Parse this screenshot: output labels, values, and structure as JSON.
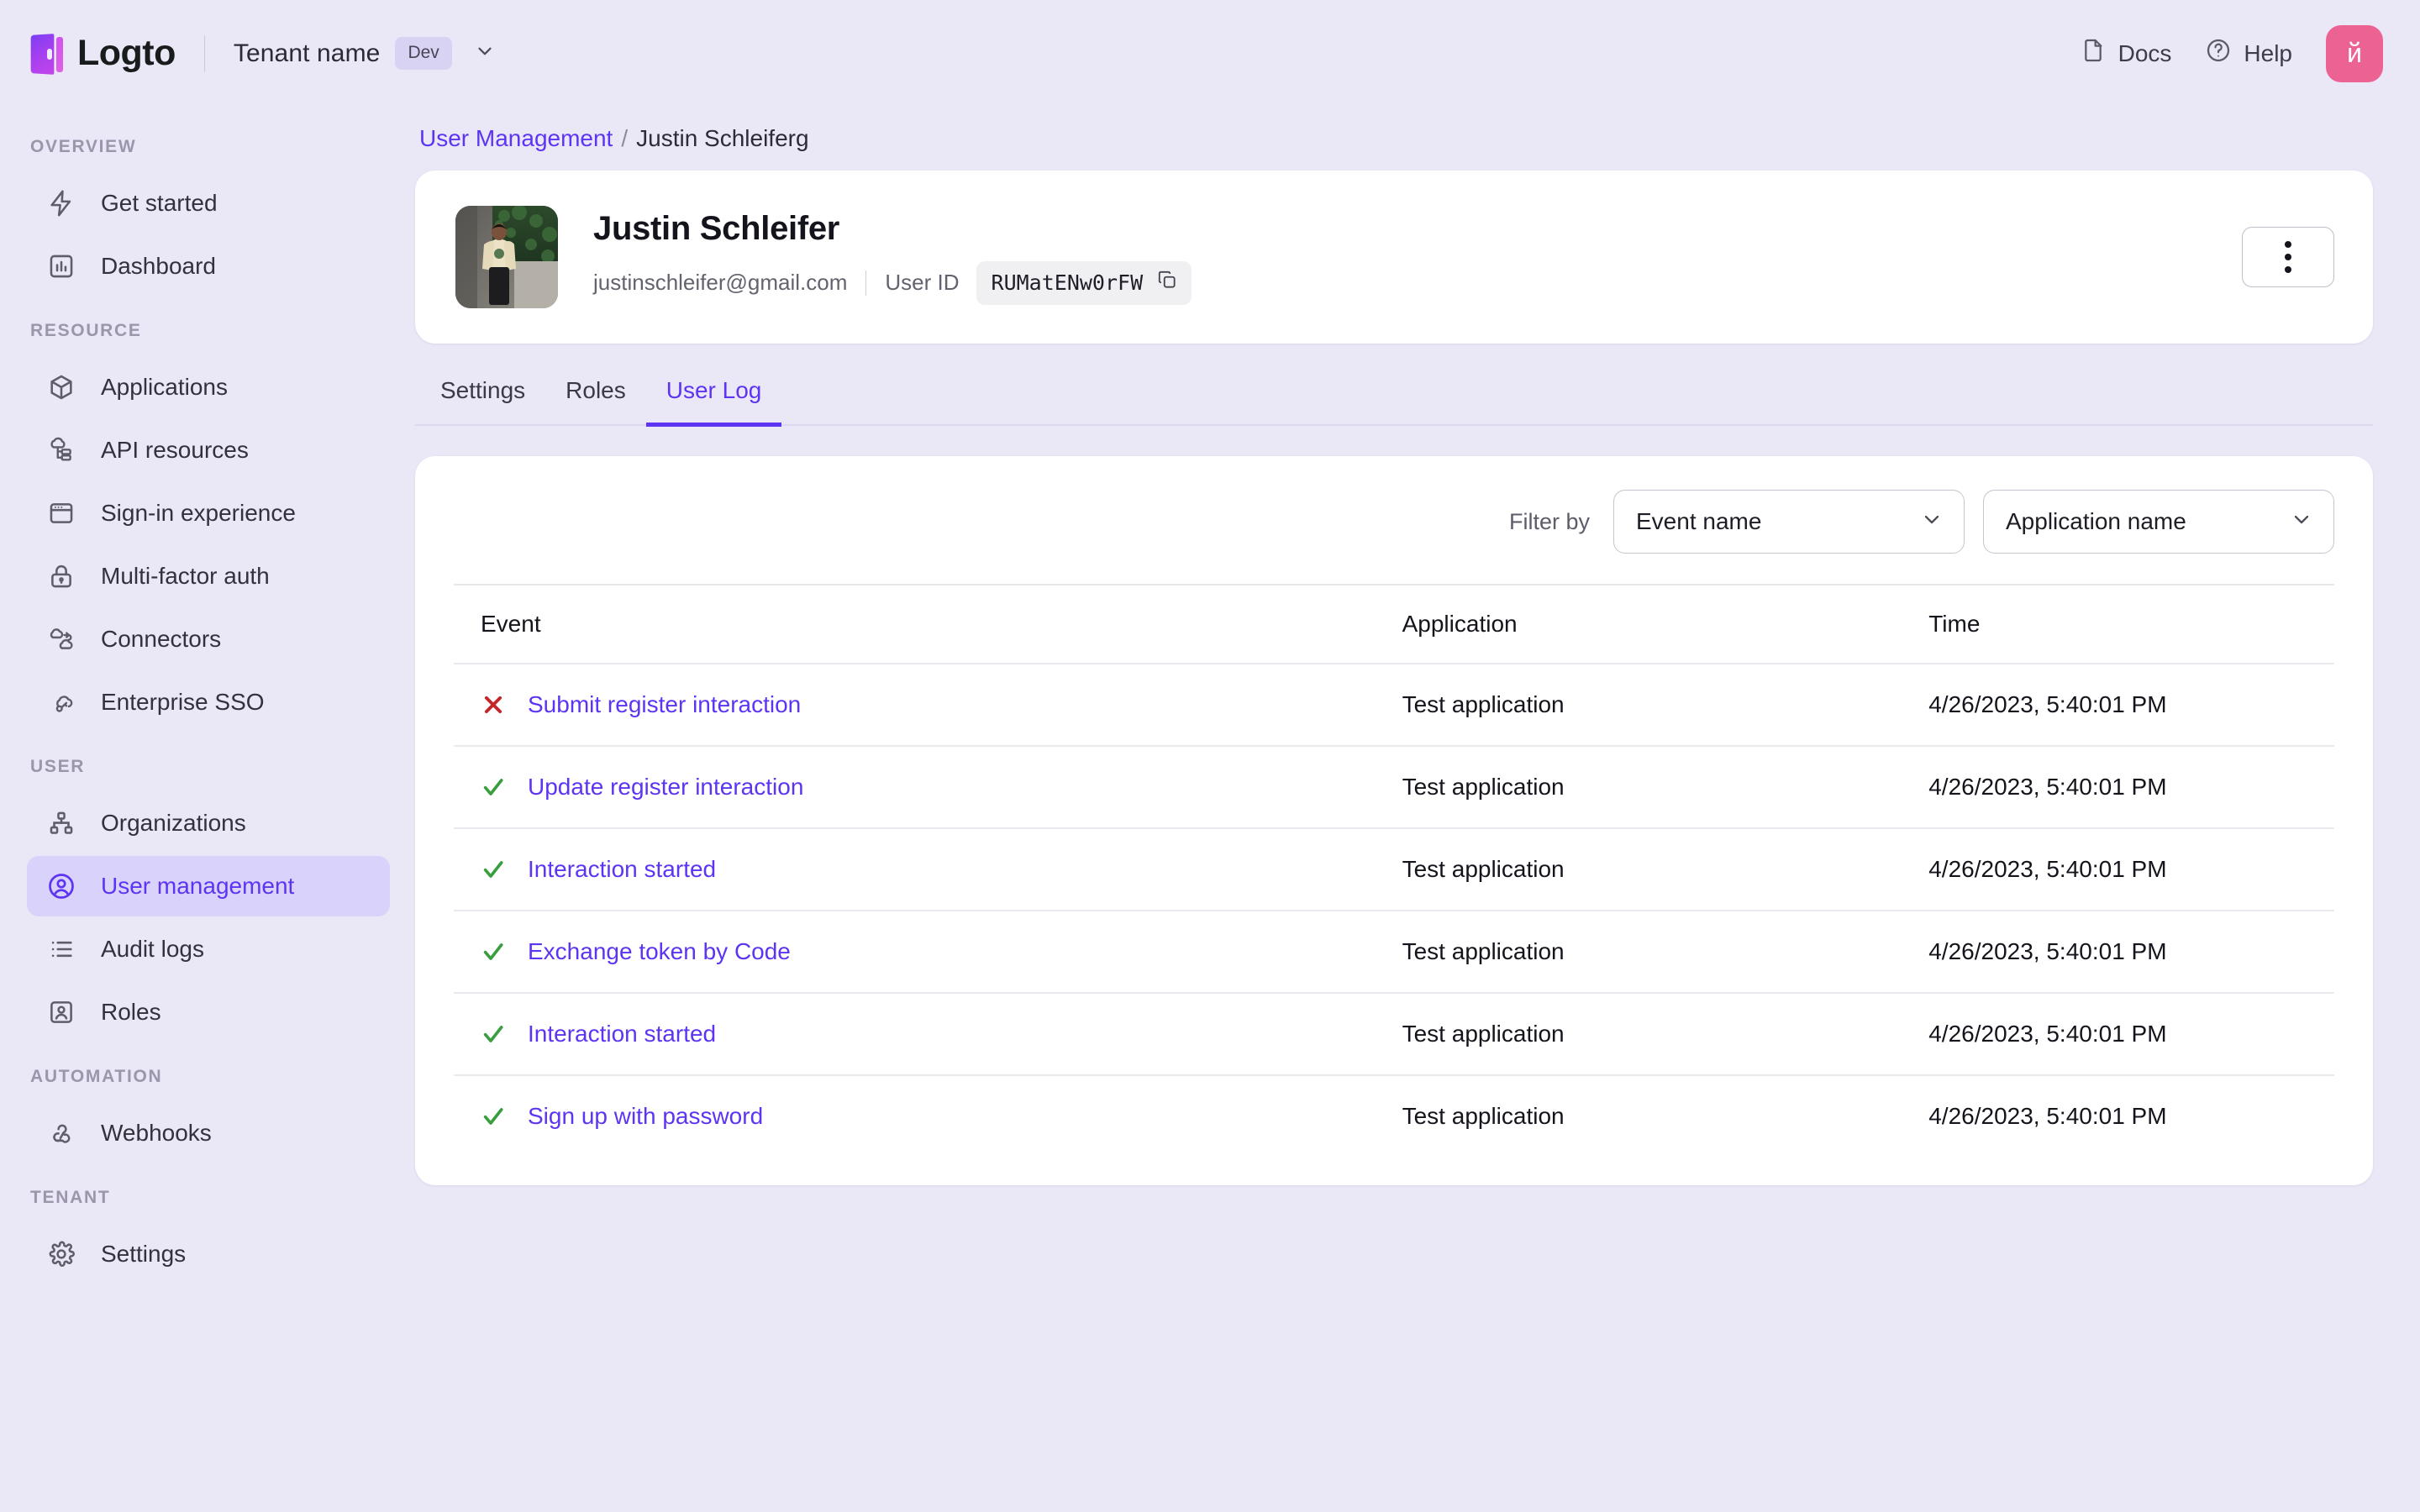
{
  "header": {
    "logo_text": "Logto",
    "tenant_name": "Tenant name",
    "env_badge": "Dev",
    "tenant_chevron_icon": "chevron-down-icon",
    "docs_label": "Docs",
    "docs_icon": "document-icon",
    "help_label": "Help",
    "help_icon": "question-circle-icon",
    "avatar_initial": "й",
    "avatar_color": "#ec6292"
  },
  "sidebar": {
    "groups": [
      {
        "title": "OVERVIEW",
        "items": [
          {
            "label": "Get started",
            "icon": "bolt-icon",
            "active": false
          },
          {
            "label": "Dashboard",
            "icon": "bar-chart-icon",
            "active": false
          }
        ]
      },
      {
        "title": "RESOURCE",
        "items": [
          {
            "label": "Applications",
            "icon": "cube-icon",
            "active": false
          },
          {
            "label": "API resources",
            "icon": "api-cloud-icon",
            "active": false
          },
          {
            "label": "Sign-in experience",
            "icon": "browser-window-icon",
            "active": false
          },
          {
            "label": "Multi-factor auth",
            "icon": "lock-icon",
            "active": false
          },
          {
            "label": "Connectors",
            "icon": "connectors-cloud-icon",
            "active": false
          },
          {
            "label": "Enterprise SSO",
            "icon": "cloud-key-icon",
            "active": false
          }
        ]
      },
      {
        "title": "USER",
        "items": [
          {
            "label": "Organizations",
            "icon": "org-tree-icon",
            "active": false
          },
          {
            "label": "User management",
            "icon": "user-circle-icon",
            "active": true
          },
          {
            "label": "Audit logs",
            "icon": "list-lines-icon",
            "active": false
          },
          {
            "label": "Roles",
            "icon": "user-badge-icon",
            "active": false
          }
        ]
      },
      {
        "title": "AUTOMATION",
        "items": [
          {
            "label": "Webhooks",
            "icon": "webhook-icon",
            "active": false
          }
        ]
      },
      {
        "title": "TENANT",
        "items": [
          {
            "label": "Settings",
            "icon": "gear-icon",
            "active": false
          }
        ]
      }
    ]
  },
  "breadcrumb": {
    "parent": "User Management",
    "separator": "/",
    "current": "Justin Schleiferg"
  },
  "user_card": {
    "name": "Justin Schleifer",
    "email": "justinschleifer@gmail.com",
    "user_id_label": "User ID",
    "user_id_value": "RUMatENw0rFW",
    "copy_icon": "copy-icon",
    "more_icon": "three-dots-vertical-icon"
  },
  "tabs": [
    {
      "label": "Settings",
      "active": false
    },
    {
      "label": "Roles",
      "active": false
    },
    {
      "label": "User Log",
      "active": true
    }
  ],
  "filters": {
    "label": "Filter by",
    "event_select": "Event name",
    "application_select": "Application name",
    "caret_icon": "chevron-down-icon"
  },
  "log_table": {
    "columns": [
      "Event",
      "Application",
      "Time"
    ],
    "rows": [
      {
        "status": "error",
        "status_icon": "x-cross-icon",
        "event": "Submit register interaction",
        "application": "Test application",
        "time": "4/26/2023, 5:40:01 PM"
      },
      {
        "status": "success",
        "status_icon": "check-icon",
        "event": "Update register interaction",
        "application": "Test application",
        "time": "4/26/2023, 5:40:01 PM"
      },
      {
        "status": "success",
        "status_icon": "check-icon",
        "event": "Interaction started",
        "application": "Test application",
        "time": "4/26/2023, 5:40:01 PM"
      },
      {
        "status": "success",
        "status_icon": "check-icon",
        "event": "Exchange token by Code",
        "application": "Test application",
        "time": "4/26/2023, 5:40:01 PM"
      },
      {
        "status": "success",
        "status_icon": "check-icon",
        "event": "Interaction started",
        "application": "Test application",
        "time": "4/26/2023, 5:40:01 PM"
      },
      {
        "status": "success",
        "status_icon": "check-icon",
        "event": "Sign up with password",
        "application": "Test application",
        "time": "4/26/2023, 5:40:01 PM"
      }
    ]
  },
  "colors": {
    "accent": "#5d34f2",
    "background": "#eae7f7",
    "sidebar_active_bg": "#d9d2fb",
    "success": "#3a9e3f",
    "error": "#c4272b",
    "card": "#ffffff"
  }
}
